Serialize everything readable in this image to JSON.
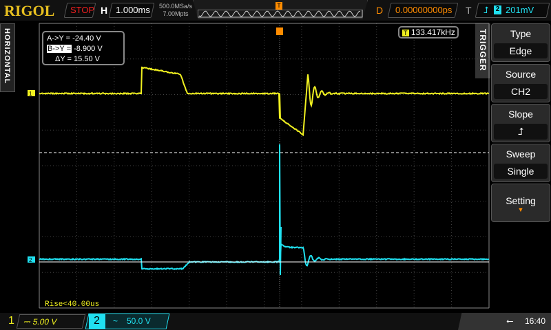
{
  "header": {
    "brand": "RIGOL",
    "run_state": "STOP",
    "timebase_label": "H",
    "timebase": "1.000ms",
    "sample_rate": "500.0MSa/s",
    "memory_depth": "7.00Mpts",
    "delay_label": "D",
    "delay": "0.00000000ps",
    "trigger_label": "T",
    "trigger_source": "2",
    "trigger_level": "201mV"
  },
  "side": {
    "horizontal": "HORIZONTAL",
    "trigger": "TRIGGER"
  },
  "cursor": {
    "a": "A->Y =",
    "a_val": "-24.40 V",
    "b": "B->Y =",
    "b_val": "-8.900 V",
    "d": "ΔY =",
    "d_val": "15.50 V"
  },
  "freq": {
    "label": "T",
    "value": "133.417kHz"
  },
  "measure": "Rise<40.00us",
  "menu": [
    {
      "title": "Type",
      "value": "Edge"
    },
    {
      "title": "Source",
      "value": "CH2"
    },
    {
      "title": "Slope",
      "value": "rising-edge-icon"
    },
    {
      "title": "Sweep",
      "value": "Single"
    },
    {
      "title": "Setting",
      "value": ""
    }
  ],
  "channels": [
    {
      "num": "1",
      "coupling": "DC",
      "scale": "5.00 V",
      "color": "#f0f020"
    },
    {
      "num": "2",
      "coupling": "AC",
      "scale": "50.0 V",
      "color": "#20e0f0"
    }
  ],
  "status": {
    "time": "16:40"
  },
  "colors": {
    "ch1": "#f0f020",
    "ch2": "#20e0f0",
    "accent": "#ff8c00"
  }
}
